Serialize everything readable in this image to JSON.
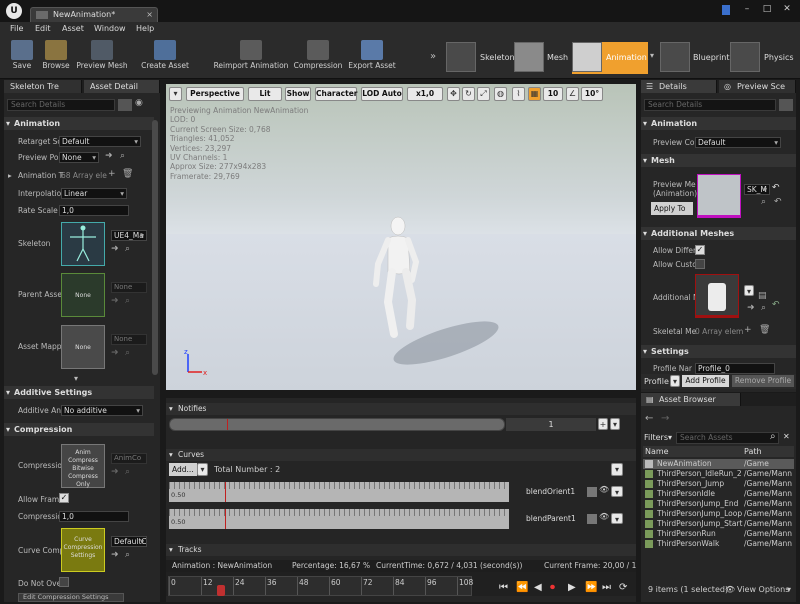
{
  "window": {
    "tab_title": "NewAnimation",
    "menu": [
      "File",
      "Edit",
      "Asset",
      "Window",
      "Help"
    ]
  },
  "toolbar": {
    "buttons": [
      {
        "label": "Save",
        "icon": "save-icon"
      },
      {
        "label": "Browse",
        "icon": "browse-icon"
      },
      {
        "label": "Preview Mesh",
        "icon": "preview-mesh-icon"
      },
      {
        "label": "Create Asset",
        "icon": "create-asset-icon"
      },
      {
        "label": "Reimport Animation",
        "icon": "reimport-icon"
      },
      {
        "label": "Compression",
        "icon": "compression-icon"
      },
      {
        "label": "Export Asset",
        "icon": "export-icon"
      }
    ],
    "modes": [
      {
        "label": "Skeleton"
      },
      {
        "label": "Mesh"
      },
      {
        "label": "Animation",
        "active": true
      },
      {
        "label": "Blueprint"
      },
      {
        "label": "Physics"
      }
    ]
  },
  "left_panel": {
    "tabs": [
      "Skeleton Tre",
      "Asset Detail"
    ],
    "search_placeholder": "Search Details",
    "animation": {
      "header": "Animation",
      "retarget_label": "Retarget Sc",
      "retarget_value": "Default",
      "preview_pose_label": "Preview Po",
      "preview_pose_value": "None",
      "anim_track_label": "Animation T",
      "anim_track_value": "68 Array ele",
      "interpolation_label": "Interpolatio",
      "interpolation_value": "Linear",
      "rate_scale_label": "Rate Scale",
      "rate_scale_value": "1,0",
      "skeleton_label": "Skeleton",
      "skeleton_value": "UE4_Ma",
      "parent_asset_label": "Parent Asse",
      "parent_asset_thumb": "None",
      "parent_asset_value": "None",
      "asset_mapping_label": "Asset Mapp",
      "asset_mapping_thumb": "None",
      "asset_mapping_value": "None"
    },
    "additive": {
      "header": "Additive Settings",
      "type_label": "Additive An",
      "type_value": "No additive"
    },
    "compression": {
      "header": "Compression",
      "compression_label": "Compressio",
      "compression_thumb": "Anim Compress Bitwise Compress Only",
      "compression_value": "AnimCo",
      "allow_frame_label": "Allow Frame",
      "compression_rate_label": "Compressio",
      "compression_rate_value": "1,0",
      "curve_comp_label": "Curve Comp",
      "curve_comp_thumb": "Curve Compression Settings",
      "curve_comp_value": "DefaultC",
      "do_not_label": "Do Not Over",
      "bottom_button": "Edit Compression Settings"
    }
  },
  "viewport": {
    "toolbar": {
      "perspective": "Perspective",
      "lit": "Lit",
      "show": "Show",
      "character": "Character",
      "lod": "LOD Auto",
      "speed": "x1,0",
      "grid_value": "10",
      "angle_value": "10°"
    },
    "stats": [
      "Previewing Animation NewAnimation",
      "LOD: 0",
      "Current Screen Size: 0,768",
      "Triangles: 41,052",
      "Vertices: 23,297",
      "UV Channels: 1",
      "Approx Size: 277x94x283",
      "Framerate: 29,769"
    ]
  },
  "timeline": {
    "notifies_header": "Notifies",
    "notify_track_index": "1",
    "curves_header": "Curves",
    "add_button": "Add...",
    "total_number": "Total Number : 2",
    "curves": [
      {
        "name": "blendOrient1",
        "value": "0.50"
      },
      {
        "name": "blendParent1",
        "value": "0.50"
      }
    ],
    "tracks_header": "Tracks",
    "status": {
      "animation": "Animation : NewAnimation",
      "percentage": "Percentage: 16,67 %",
      "current_time": "CurrentTime: 0,672 / 4,031 (second(s))",
      "current_frame": "Current Frame: 20,00 / 120 Frame"
    },
    "ruler_ticks": [
      "0",
      "12",
      "24",
      "36",
      "48",
      "60",
      "72",
      "84",
      "96",
      "108"
    ]
  },
  "right_panel": {
    "tabs": [
      "Details",
      "Preview Sce"
    ],
    "search_placeholder": "Search Details",
    "animation_header": "Animation",
    "preview_controller_label": "Preview Co",
    "preview_controller_value": "Default",
    "mesh_header": "Mesh",
    "preview_mesh_label": "Preview Me (Animation)",
    "preview_mesh_value": "SK_M",
    "apply_button": "Apply To",
    "additional_meshes_header": "Additional Meshes",
    "allow_diff_label": "Allow Differ",
    "allow_custom_label": "Allow Custo",
    "additional_label": "Additional M",
    "skeletal_mesh_label": "Skeletal Me",
    "skeletal_mesh_value": "0 Array elem",
    "settings_header": "Settings",
    "profile_name_label": "Profile Nar",
    "profile_name_value": "Profile_0",
    "profile_label": "Profile",
    "add_profile": "Add Profile",
    "remove_profile": "Remove Profile"
  },
  "asset_browser": {
    "tab": "Asset Browser",
    "filters": "Filters",
    "search_placeholder": "Search Assets",
    "col_name": "Name",
    "col_path": "Path",
    "rows": [
      {
        "name": "NewAnimation",
        "path": "/Game",
        "selected": true
      },
      {
        "name": "ThirdPerson_IdleRun_2",
        "path": "/Game/Mann"
      },
      {
        "name": "ThirdPerson_Jump",
        "path": "/Game/Mann"
      },
      {
        "name": "ThirdPersonIdle",
        "path": "/Game/Mann"
      },
      {
        "name": "ThirdPersonJump_End",
        "path": "/Game/Mann"
      },
      {
        "name": "ThirdPersonJump_Loop",
        "path": "/Game/Mann"
      },
      {
        "name": "ThirdPersonJump_Start",
        "path": "/Game/Mann"
      },
      {
        "name": "ThirdPersonRun",
        "path": "/Game/Mann"
      },
      {
        "name": "ThirdPersonWalk",
        "path": "/Game/Mann"
      }
    ],
    "footer": "9 items (1 selected)",
    "view_options": "View Options"
  }
}
